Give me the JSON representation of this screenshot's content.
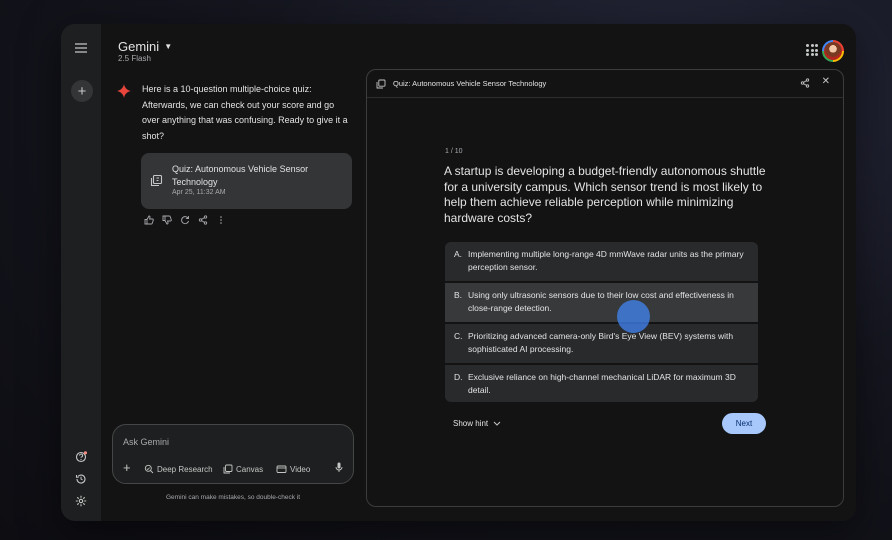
{
  "app": {
    "title": "Gemini",
    "model": "2.5 Flash"
  },
  "chat": {
    "response_text": "Here is a 10-question multiple-choice quiz: Afterwards, we can check out your score and go over anything that was confusing. Ready to give it a shot?",
    "card": {
      "title": "Quiz: Autonomous Vehicle Sensor Technology",
      "date": "Apr 25, 11:32 AM"
    }
  },
  "input": {
    "placeholder": "Ask Gemini",
    "tools": {
      "deep_research": "Deep Research",
      "canvas": "Canvas",
      "video": "Video"
    },
    "disclaimer": "Gemini can make mistakes, so double-check it"
  },
  "quiz": {
    "panel_title": "Quiz: Autonomous Vehicle Sensor Technology",
    "progress": "1 / 10",
    "question": "A startup is developing a budget-friendly autonomous shuttle for a university campus. Which sensor trend is most likely to help them achieve reliable perception while minimizing hardware costs?",
    "options": [
      {
        "letter": "A.",
        "text": "Implementing multiple long-range 4D mmWave radar units as the primary perception sensor."
      },
      {
        "letter": "B.",
        "text": "Using only ultrasonic sensors due to their low cost and effectiveness in close-range detection."
      },
      {
        "letter": "C.",
        "text": "Prioritizing advanced camera-only Bird's Eye View (BEV) systems with sophisticated AI processing."
      },
      {
        "letter": "D.",
        "text": "Exclusive reliance on high-channel mechanical LiDAR for maximum 3D detail."
      }
    ],
    "hint_label": "Show hint",
    "next_label": "Next"
  },
  "colors": {
    "accent": "#a8c7fa",
    "cursor": "#4285f4",
    "notification_dot": "#f28b82"
  }
}
